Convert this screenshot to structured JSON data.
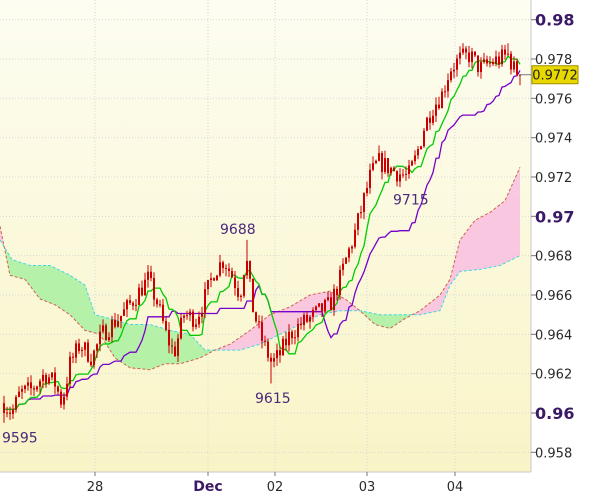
{
  "chart_data": {
    "type": "candlestick",
    "title": "",
    "xlabel": "",
    "ylabel": "",
    "ylim": [
      0.957,
      0.981
    ],
    "y_ticks": [
      {
        "value": 0.98,
        "label": "0.98",
        "major": true
      },
      {
        "value": 0.978,
        "label": "0.978",
        "major": false
      },
      {
        "value": 0.976,
        "label": "0.976",
        "major": false
      },
      {
        "value": 0.974,
        "label": "0.974",
        "major": false
      },
      {
        "value": 0.972,
        "label": "0.972",
        "major": false
      },
      {
        "value": 0.97,
        "label": "0.97",
        "major": true
      },
      {
        "value": 0.968,
        "label": "0.968",
        "major": false
      },
      {
        "value": 0.966,
        "label": "0.966",
        "major": false
      },
      {
        "value": 0.964,
        "label": "0.964",
        "major": false
      },
      {
        "value": 0.962,
        "label": "0.962",
        "major": false
      },
      {
        "value": 0.96,
        "label": "0.96",
        "major": true
      },
      {
        "value": 0.958,
        "label": "0.958",
        "major": false
      }
    ],
    "x_ticks": [
      {
        "label": "28",
        "bold": false
      },
      {
        "label": "Dec",
        "bold": true
      },
      {
        "label": "02",
        "bold": false
      },
      {
        "label": "03",
        "bold": false
      },
      {
        "label": "04",
        "bold": false
      }
    ],
    "current_price": {
      "value": 0.9772,
      "label": "0.9772"
    },
    "annotations": [
      {
        "text": "9595",
        "value": 0.9595
      },
      {
        "text": "9688",
        "value": 0.9688
      },
      {
        "text": "9615",
        "value": 0.9615
      },
      {
        "text": "9715",
        "value": 0.9715
      }
    ],
    "grid": true,
    "legend": "none",
    "colors": {
      "candle": "#cc0000",
      "tenkan": "#00cc00",
      "kijun": "#7700cc",
      "cloud_bull": "#a8f0a0",
      "cloud_bear": "#f8c0e0",
      "senkou_a": "#40d8e0",
      "senkou_b": "#d06050",
      "price_badge": "#e8d800"
    }
  }
}
